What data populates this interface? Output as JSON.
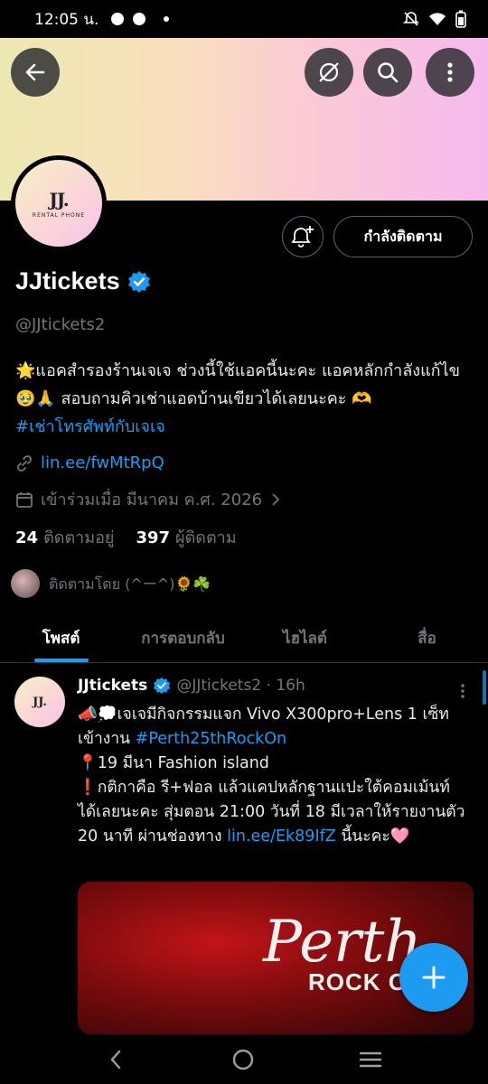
{
  "status_bar": {
    "time": "12:05 น."
  },
  "profile": {
    "avatar_logo": "JJ.",
    "avatar_sub": "RENTAL PHONE",
    "follow_button": "กำลังติดตาม",
    "display_name": "JJtickets",
    "handle": "@JJtickets2",
    "bio_line1": "🌟แอคสำรองร้านเจเจ ช่วงนี้ใช้แอคนี้นะคะ แอคหลักกำลังแก้ไข🥹🙏 สอบถามคิวเช่าแอดบ้านเขียวได้เลยนะคะ 🫶",
    "bio_hashtag": "#เช่าโทรศัพท์กับเจเจ",
    "website": "lin.ee/fwMtRpQ",
    "joined": "เข้าร่วมเมื่อ มีนาคม ค.ศ. 2026",
    "following_count": "24",
    "following_label": "ติดตามอยู่",
    "followers_count": "397",
    "followers_label": "ผู้ติดตาม",
    "followed_by": "ติดตามโดย (^ー^)🌻☘️"
  },
  "tabs": [
    {
      "label": "โพสต์"
    },
    {
      "label": "การตอบกลับ"
    },
    {
      "label": "ไฮไลต์"
    },
    {
      "label": "สื่อ"
    }
  ],
  "post": {
    "name": "JJtickets",
    "handle_time": "@JJtickets2 · 16h",
    "avatar_logo": "JJ.",
    "line1_prefix": "📣💭เจเจมีกิจกรรมแจก Vivo X300pro+Lens 1 เซ็ท เข้างาน ",
    "line1_tag": "#Perth25thRockOn",
    "line2": "📍19 มีนา Fashion island",
    "line3_prefix": "❗กติกาคือ รี+ฟอล แล้วแคปหลักฐานแปะใต้คอมเม้นท์ได้เลยนะคะ สุ่มตอน 21:00 วันที่ 18 มีเวลาให้รายงานตัว 20 นาที ผ่านช่องทาง ",
    "line3_link": "lin.ee/Ek89IfZ",
    "line3_suffix": " นี้นะคะ🩷",
    "media_title": "Perth",
    "media_sub": "ROCK O"
  }
}
